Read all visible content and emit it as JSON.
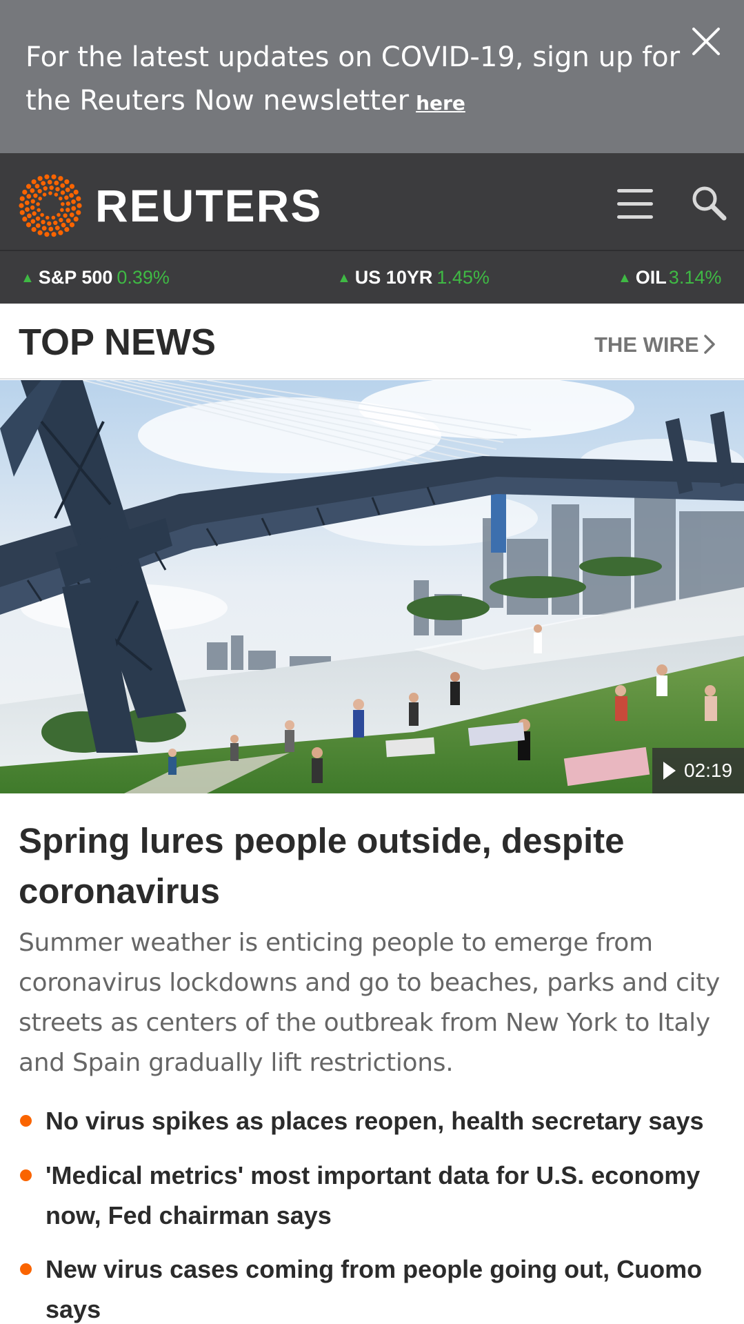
{
  "banner": {
    "text": "For the latest updates on COVID-19, sign up for the Reuters Now newsletter",
    "link_label": "here"
  },
  "header": {
    "logo_text": "REUTERS",
    "brand_color": "#fa6400"
  },
  "ticker": [
    {
      "name": "S&P 500",
      "change": "0.39%",
      "direction": "up"
    },
    {
      "name": "US 10YR",
      "change": "1.45%",
      "direction": "up"
    },
    {
      "name": "OIL",
      "change": "3.14%",
      "direction": "up"
    }
  ],
  "section": {
    "title": "TOP NEWS",
    "wire_label": "THE WIRE"
  },
  "lead_story": {
    "video_duration": "02:19",
    "headline": "Spring lures people outside, despite coronavirus",
    "summary": "Summer weather is enticing people to emerge from coronavirus lockdowns and go to beaches, parks and city streets as centers of the outbreak from New York to Italy and Spain gradually lift restrictions."
  },
  "related": [
    "No virus spikes as places reopen, health secretary says",
    "'Medical metrics' most important data for U.S. economy now, Fed chairman says",
    "New virus cases coming from people going out, Cuomo says"
  ],
  "colors": {
    "banner_bg": "#76787c",
    "header_bg": "#3c3c3e",
    "ticker_up": "#3fb944",
    "accent": "#fa6400"
  }
}
